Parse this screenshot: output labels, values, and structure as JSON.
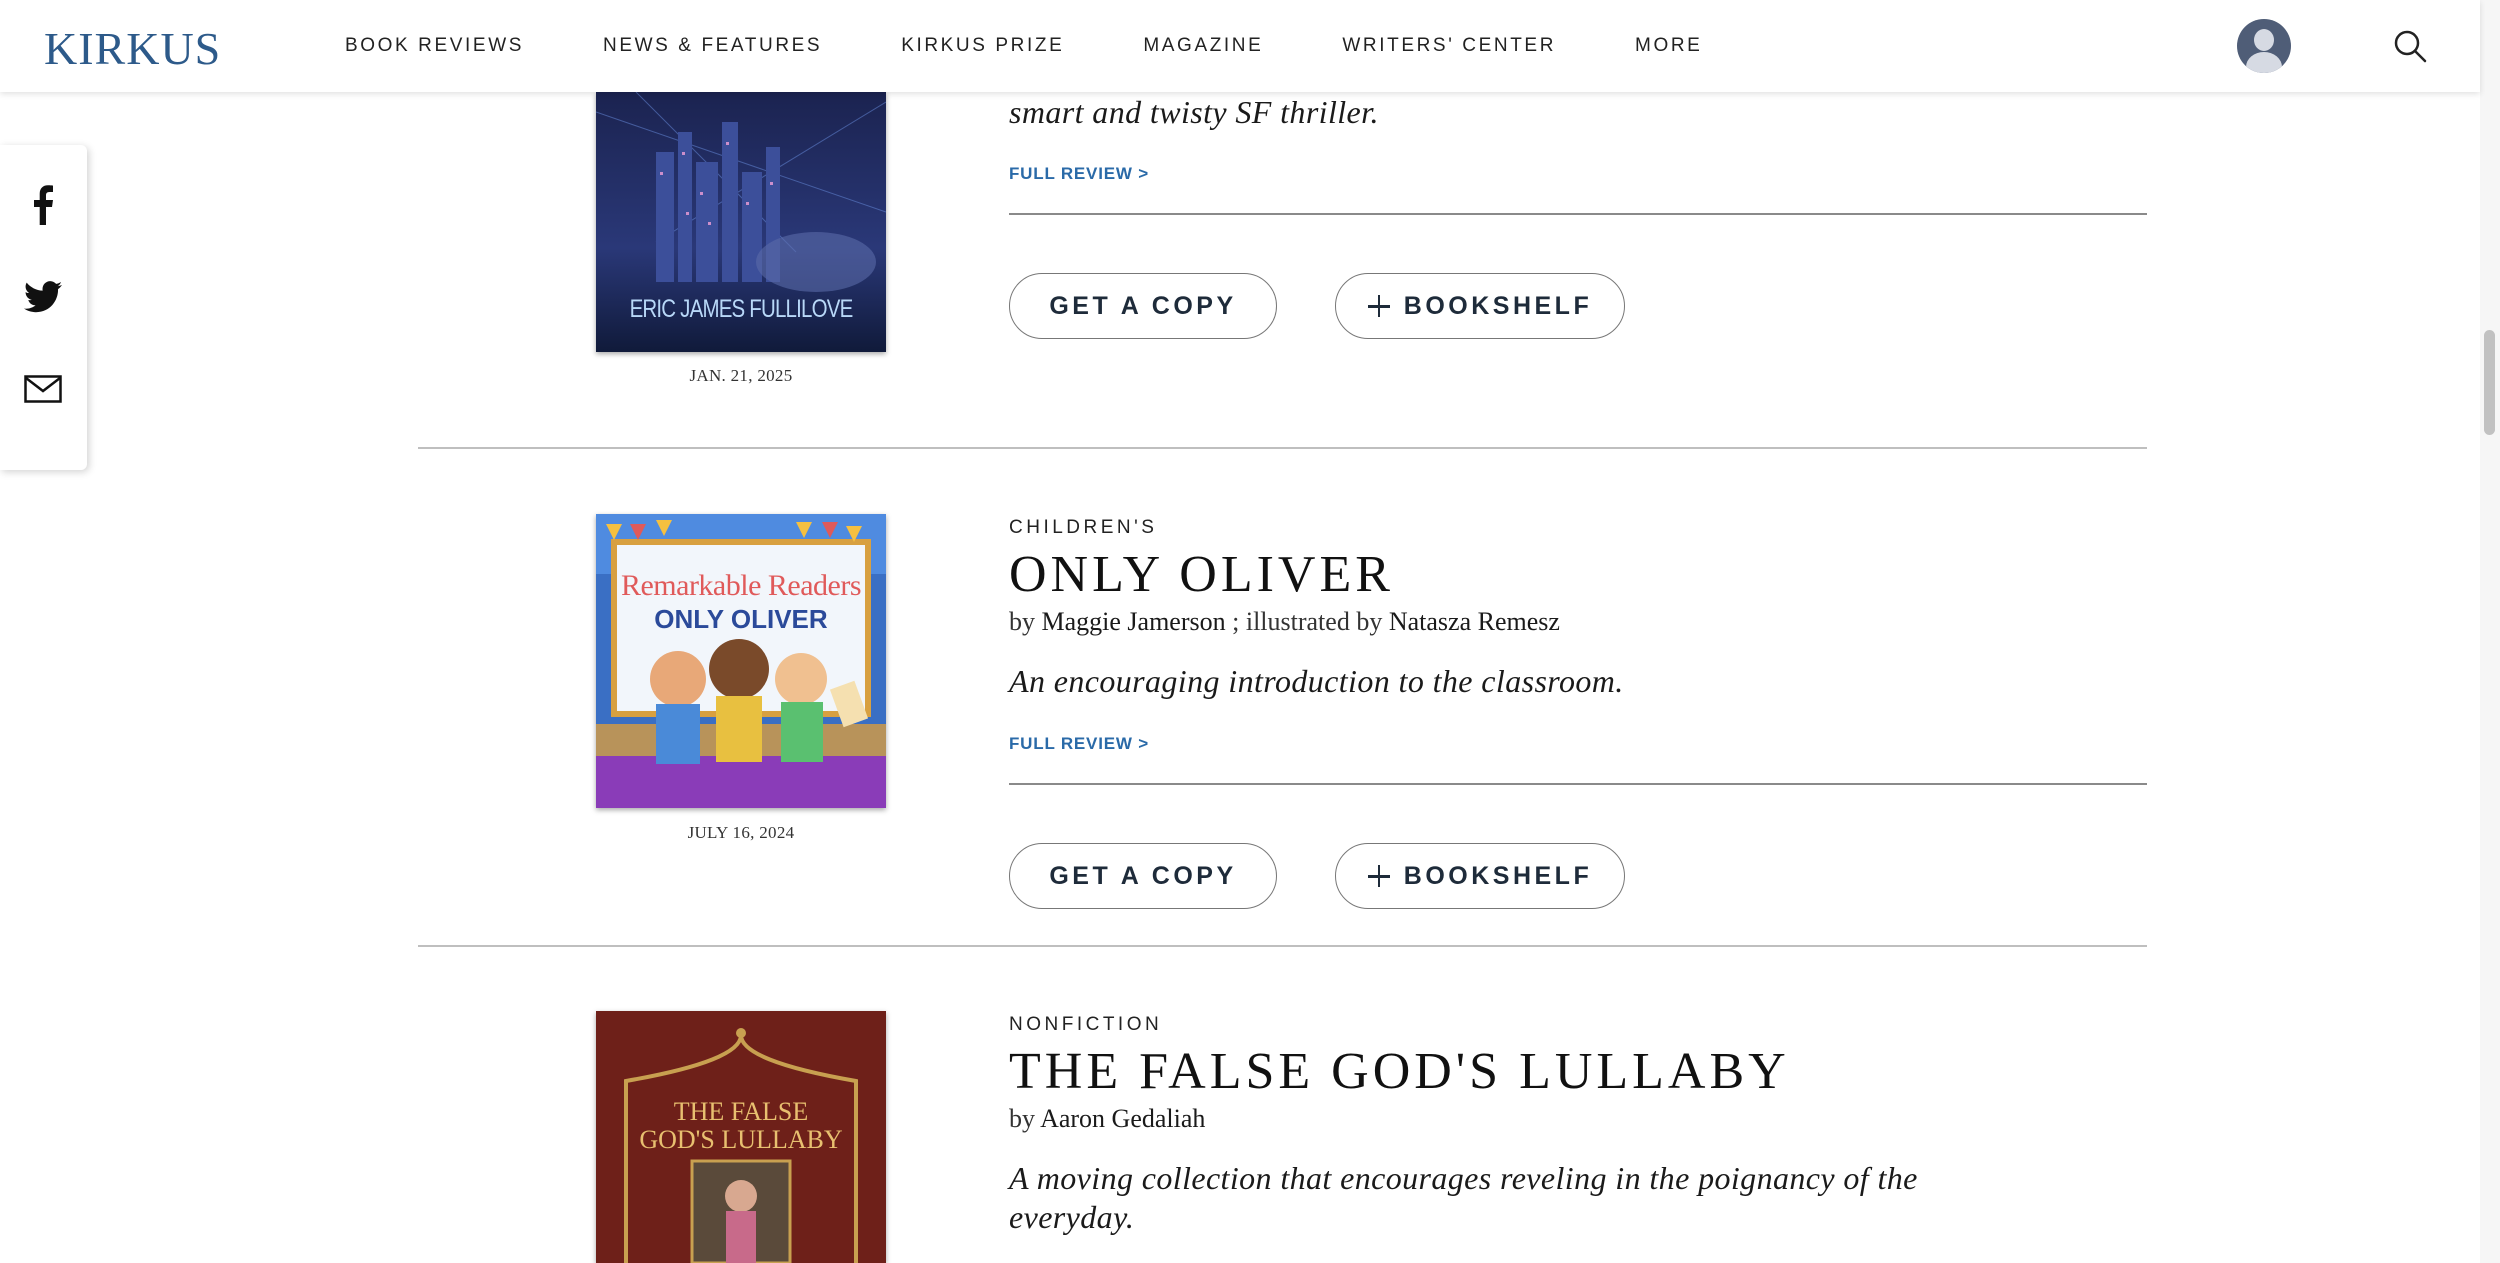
{
  "header": {
    "logo": "KIRKUS",
    "nav": [
      {
        "label": "BOOK REVIEWS"
      },
      {
        "label": "NEWS & FEATURES"
      },
      {
        "label": "KIRKUS PRIZE"
      },
      {
        "label": "MAGAZINE"
      },
      {
        "label": "WRITERS' CENTER"
      },
      {
        "label": "MORE"
      }
    ],
    "avatar_icon": "user-avatar-icon",
    "search_icon": "search-icon"
  },
  "share": {
    "icons": [
      "facebook-icon",
      "twitter-icon",
      "email-icon"
    ]
  },
  "buttons": {
    "get_copy": "GET A COPY",
    "bookshelf": "BOOKSHELF"
  },
  "books": [
    {
      "cover_author": "ERIC JAMES FULLILOVE",
      "pub_date": "JAN. 21, 2025",
      "tagline": "smart and twisty SF thriller.",
      "full_review": "FULL REVIEW >"
    },
    {
      "genre": "CHILDREN'S",
      "title": "ONLY OLIVER",
      "by": "by",
      "author": "Maggie Jamerson",
      "illustrated_prefix": "; illustrated by",
      "illustrator": "Natasza Remesz",
      "tagline": "An encouraging introduction to the classroom.",
      "full_review": "FULL REVIEW >",
      "pub_date": "JULY 16, 2024",
      "cover_series": "Remarkable Readers",
      "cover_title": "ONLY OLIVER"
    },
    {
      "genre": "NONFICTION",
      "title": "THE FALSE GOD'S LULLABY",
      "by": "by",
      "author": "Aaron Gedaliah",
      "tagline": "A moving collection that encourages reveling in the poignancy of the everyday.",
      "cover_title_line1": "THE FALSE",
      "cover_title_line2": "GOD'S LULLABY"
    }
  ],
  "colors": {
    "brand_blue": "#2d5a8a",
    "link_blue": "#2a6aa8",
    "button_text": "#1e2b3a"
  }
}
